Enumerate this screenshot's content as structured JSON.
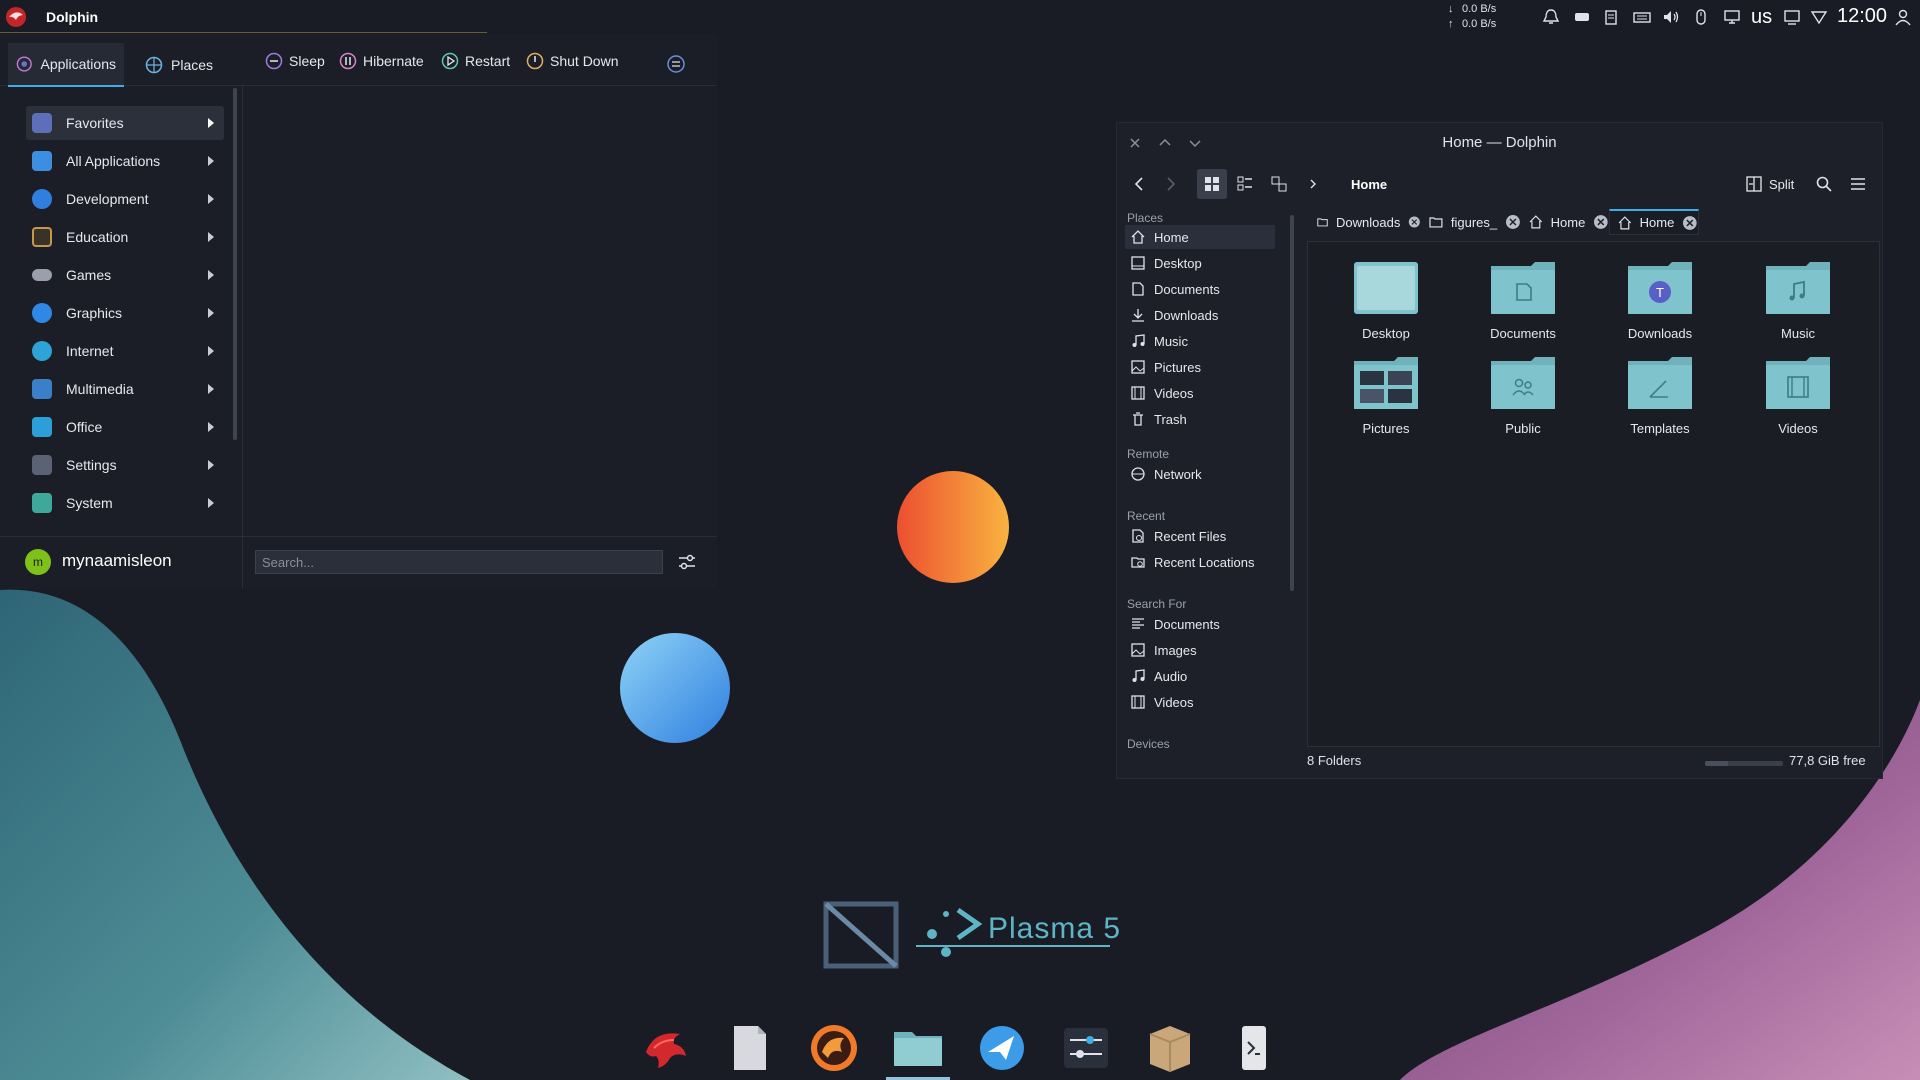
{
  "top_panel": {
    "app_title": "Dolphin",
    "net_down": "0.0 B/s",
    "net_up": "0.0 B/s",
    "keyboard_layout": "us",
    "clock": "12:00"
  },
  "launcher": {
    "tabs": [
      {
        "label": "Applications"
      },
      {
        "label": "Places"
      }
    ],
    "power": {
      "sleep": "Sleep",
      "hibernate": "Hibernate",
      "restart": "Restart",
      "shutdown": "Shut Down"
    },
    "categories": [
      {
        "label": "Favorites",
        "color": "#5d6fb8"
      },
      {
        "label": "All Applications",
        "color": "#3d8ee0"
      },
      {
        "label": "Development",
        "color": "#2f7fe0"
      },
      {
        "label": "Education",
        "color": "#c49a4a"
      },
      {
        "label": "Games",
        "color": "#9aa0ab"
      },
      {
        "label": "Graphics",
        "color": "#2f88e8"
      },
      {
        "label": "Internet",
        "color": "#2ea3d8"
      },
      {
        "label": "Multimedia",
        "color": "#3a7fc8"
      },
      {
        "label": "Office",
        "color": "#2d9fd8"
      },
      {
        "label": "Settings",
        "color": "#5a6274"
      },
      {
        "label": "System",
        "color": "#3ea89a"
      }
    ],
    "username": "mynaamisleon",
    "avatar_letter": "m",
    "search_placeholder": "Search..."
  },
  "dolphin": {
    "window_title": "Home — Dolphin",
    "breadcrumb": "Home",
    "split_label": "Split",
    "places_header": "Places",
    "places": [
      {
        "label": "Home",
        "icon": "home-icon"
      },
      {
        "label": "Desktop",
        "icon": "desktop-icon"
      },
      {
        "label": "Documents",
        "icon": "documents-icon"
      },
      {
        "label": "Downloads",
        "icon": "downloads-icon"
      },
      {
        "label": "Music",
        "icon": "music-icon"
      },
      {
        "label": "Pictures",
        "icon": "pictures-icon"
      },
      {
        "label": "Videos",
        "icon": "videos-icon"
      },
      {
        "label": "Trash",
        "icon": "trash-icon"
      }
    ],
    "remote_header": "Remote",
    "remote": [
      {
        "label": "Network",
        "icon": "network-icon"
      }
    ],
    "recent_header": "Recent",
    "recent": [
      {
        "label": "Recent Files",
        "icon": "recent-files-icon"
      },
      {
        "label": "Recent Locations",
        "icon": "recent-locations-icon"
      }
    ],
    "search_header": "Search For",
    "search_for": [
      {
        "label": "Documents",
        "icon": "documents-icon"
      },
      {
        "label": "Images",
        "icon": "images-icon"
      },
      {
        "label": "Audio",
        "icon": "audio-icon"
      },
      {
        "label": "Videos",
        "icon": "videos-icon"
      }
    ],
    "devices_header": "Devices",
    "tabs": [
      {
        "label": "Downloads",
        "icon": "folder-icon"
      },
      {
        "label": "figures_",
        "icon": "folder-icon"
      },
      {
        "label": "Home",
        "icon": "home-icon"
      },
      {
        "label": "Home",
        "icon": "home-icon"
      }
    ],
    "folders": [
      {
        "name": "Desktop"
      },
      {
        "name": "Documents"
      },
      {
        "name": "Downloads"
      },
      {
        "name": "Music"
      },
      {
        "name": "Pictures"
      },
      {
        "name": "Public"
      },
      {
        "name": "Templates"
      },
      {
        "name": "Videos"
      }
    ],
    "status": "8 Folders",
    "free_space": "77,8 GiB free",
    "used_fraction": 0.3
  },
  "desktop": {
    "logo_text": "Plasma 5"
  },
  "dock": {
    "items": [
      {
        "icon": "garuda-eagle-icon"
      },
      {
        "icon": "text-file-icon"
      },
      {
        "icon": "firedragon-browser-icon"
      },
      {
        "icon": "file-manager-icon"
      },
      {
        "icon": "kdeconnect-icon"
      },
      {
        "icon": "system-settings-icon"
      },
      {
        "icon": "package-icon"
      },
      {
        "icon": "terminal-icon"
      }
    ]
  },
  "colors": {
    "accent": "#3daee9",
    "folder": "#7fc4cc",
    "panel_bg": "#1a1c25"
  }
}
